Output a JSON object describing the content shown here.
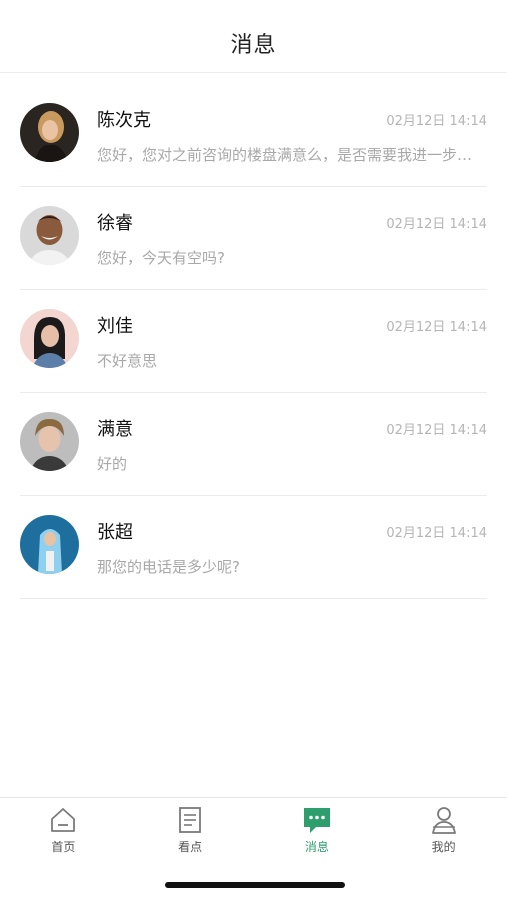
{
  "header": {
    "title": "消息"
  },
  "conversations": [
    {
      "name": "陈次克",
      "time": "02月12日 14:14",
      "preview": "您好，您对之前咨询的楼盘满意么，是否需要我进一步为您介绍？",
      "avatar_color": "#3a2e2a"
    },
    {
      "name": "徐睿",
      "time": "02月12日 14:14",
      "preview": "您好，今天有空吗?",
      "avatar_color": "#8a6a55"
    },
    {
      "name": "刘佳",
      "time": "02月12日 14:14",
      "preview": "不好意思",
      "avatar_color": "#e8c9c4"
    },
    {
      "name": "满意",
      "time": "02月12日 14:14",
      "preview": "好的",
      "avatar_color": "#6a6a6a"
    },
    {
      "name": "张超",
      "time": "02月12日 14:14",
      "preview": "那您的电话是多少呢?",
      "avatar_color": "#2b7fb0"
    }
  ],
  "tabbar": {
    "items": [
      {
        "label": "首页",
        "icon": "home-icon"
      },
      {
        "label": "看点",
        "icon": "article-icon"
      },
      {
        "label": "消息",
        "icon": "message-icon",
        "active": true
      },
      {
        "label": "我的",
        "icon": "profile-icon"
      }
    ]
  },
  "colors": {
    "accent": "#2f9e6e",
    "muted_text": "#a8a8a8"
  }
}
